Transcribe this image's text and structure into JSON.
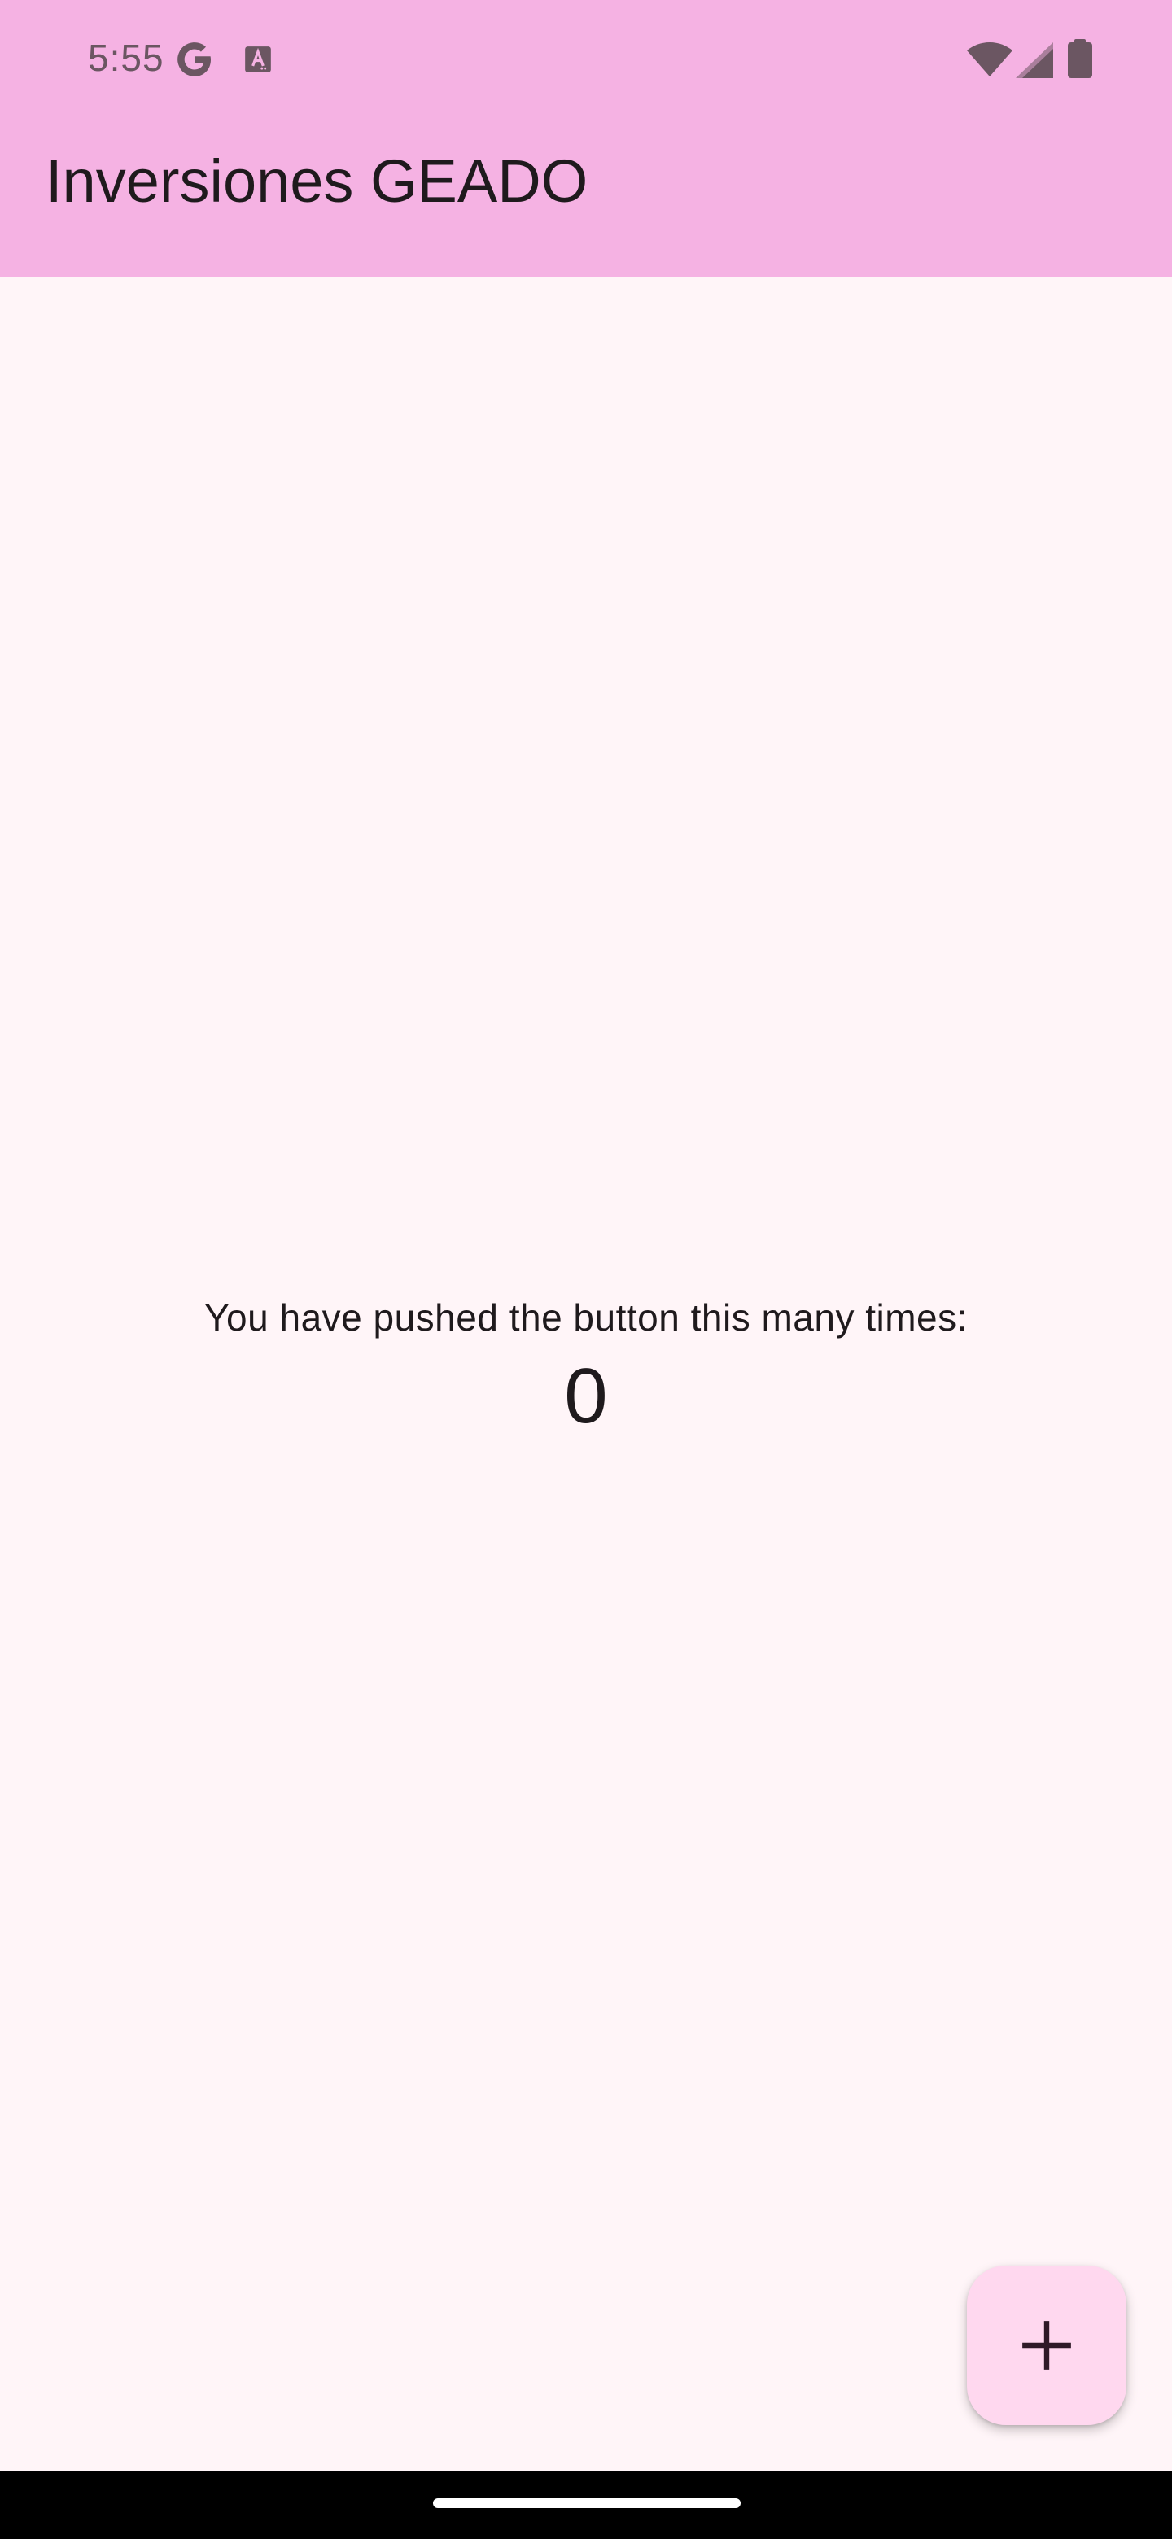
{
  "status_bar": {
    "time": "5:55",
    "icons": [
      "google-icon",
      "keyboard-a-icon",
      "wifi-icon",
      "cell-signal-icon",
      "battery-icon"
    ]
  },
  "app_bar": {
    "title": "Inversiones GEADO"
  },
  "main": {
    "message": "You have pushed the button this many times:",
    "counter": "0"
  },
  "fab": {
    "icon": "plus-icon"
  },
  "colors": {
    "app_bar": "#f5b2e3",
    "background": "#fff5f8",
    "fab": "#ffd8ef",
    "text": "#1f1a1d"
  }
}
